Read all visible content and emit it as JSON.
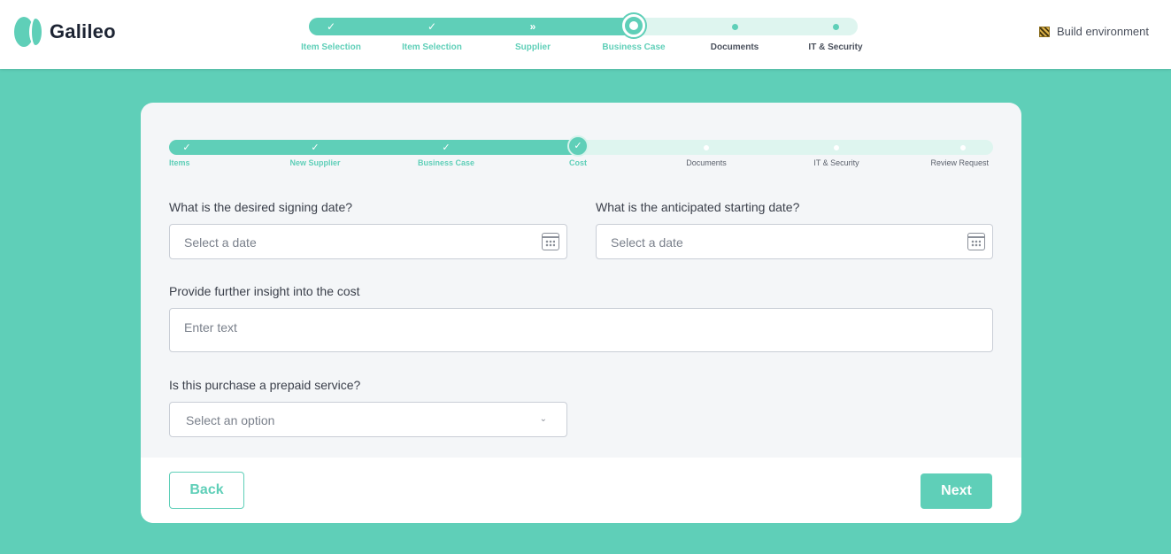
{
  "app": {
    "name": "Galileo"
  },
  "environment": {
    "label": "Build environment",
    "icon": "hazard-stripes-icon"
  },
  "top_progress": {
    "steps": [
      {
        "label": "Item Selection",
        "state": "complete",
        "icon": "check-icon"
      },
      {
        "label": "Item Selection",
        "state": "complete",
        "icon": "check-icon"
      },
      {
        "label": "Supplier",
        "state": "skipped",
        "icon": "double-chevron-right-icon"
      },
      {
        "label": "Business Case",
        "state": "current",
        "icon": "current-step-icon"
      },
      {
        "label": "Documents",
        "state": "upcoming",
        "icon": "dot-icon"
      },
      {
        "label": "IT & Security",
        "state": "upcoming",
        "icon": "dot-icon"
      }
    ]
  },
  "form_progress": {
    "steps": [
      {
        "label": "Items",
        "state": "complete",
        "icon": "check-icon"
      },
      {
        "label": "New Supplier",
        "state": "complete",
        "icon": "check-icon"
      },
      {
        "label": "Business Case",
        "state": "complete",
        "icon": "check-icon"
      },
      {
        "label": "Cost",
        "state": "current",
        "icon": "check-icon"
      },
      {
        "label": "Documents",
        "state": "upcoming",
        "icon": "dot-icon"
      },
      {
        "label": "IT & Security",
        "state": "upcoming",
        "icon": "dot-icon"
      },
      {
        "label": "Review Request",
        "state": "upcoming",
        "icon": "dot-icon"
      }
    ]
  },
  "form": {
    "signing_date": {
      "label": "What is the desired signing date?",
      "placeholder": "Select a date",
      "value": ""
    },
    "starting_date": {
      "label": "What is the anticipated starting date?",
      "placeholder": "Select a date",
      "value": ""
    },
    "cost_insight": {
      "label": "Provide further insight into the cost",
      "placeholder": "Enter text",
      "value": ""
    },
    "prepaid": {
      "label": "Is this purchase a prepaid service?",
      "placeholder": "Select an option",
      "value": ""
    }
  },
  "actions": {
    "back_label": "Back",
    "next_label": "Next"
  },
  "colors": {
    "accent": "#5fcfb8",
    "accent_light": "#def5ef",
    "card_bg": "#f4f6f8",
    "text": "#3a3f4a"
  }
}
